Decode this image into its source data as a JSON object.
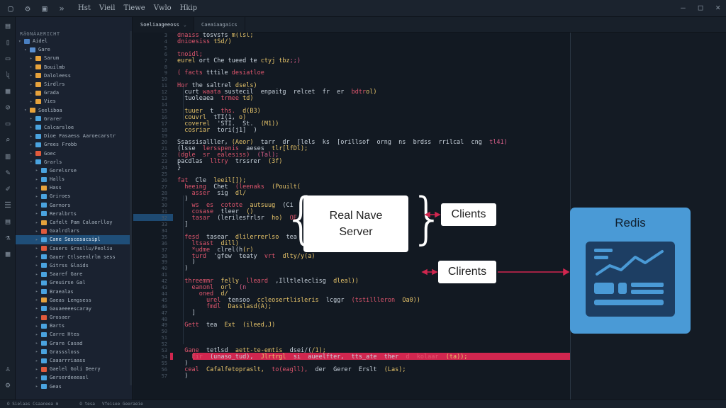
{
  "titlebar": {
    "menu": [
      "Hst",
      "Vieil",
      "Tiewe",
      "Vwlo",
      "Hkip"
    ],
    "controls": [
      "–",
      "□",
      "✕"
    ]
  },
  "explorer": {
    "header": "RäGNÀAERICHT",
    "items": [
      {
        "label": "Aidel",
        "depth": 0,
        "color": "#4a7fc1",
        "caret": "▾"
      },
      {
        "label": "Gare",
        "depth": 1,
        "color": "#5a8fd0",
        "caret": "▾"
      },
      {
        "label": "Sarum",
        "depth": 2,
        "color": "#e6a23c",
        "caret": "▸"
      },
      {
        "label": "Bouilmb",
        "depth": 2,
        "color": "#e6a23c",
        "caret": "▸"
      },
      {
        "label": "Daloleess",
        "depth": 2,
        "color": "#e6a23c",
        "caret": "▸"
      },
      {
        "label": "Sirdlrs",
        "depth": 2,
        "color": "#e6a23c",
        "caret": "▸"
      },
      {
        "label": "Grada",
        "depth": 2,
        "color": "#e6a23c",
        "caret": "▸"
      },
      {
        "label": "Vies",
        "depth": 2,
        "color": "#e6a23c",
        "caret": "▸"
      },
      {
        "label": "Seeliboa",
        "depth": 1,
        "color": "#e6a23c",
        "caret": "▾"
      },
      {
        "label": "Grarer",
        "depth": 2,
        "color": "#4aa3df",
        "caret": "▸"
      },
      {
        "label": "Calcarsloe",
        "depth": 2,
        "color": "#4aa3df",
        "caret": "▸"
      },
      {
        "label": "Dioe Fasaess Aaroecarstr",
        "depth": 2,
        "color": "#4aa3df",
        "caret": "▸"
      },
      {
        "label": "Grees Frobb",
        "depth": 2,
        "color": "#4aa3df",
        "caret": "▸"
      },
      {
        "label": "Goec",
        "depth": 2,
        "color": "#e05a3c",
        "caret": "▸"
      },
      {
        "label": "Grarls",
        "depth": 2,
        "color": "#4aa3df",
        "caret": "▾"
      },
      {
        "label": "Gorelsrse",
        "depth": 3,
        "color": "#4aa3df",
        "caret": "▸"
      },
      {
        "label": "Halls",
        "depth": 3,
        "color": "#4aa3df",
        "caret": "▸"
      },
      {
        "label": "Hass",
        "depth": 3,
        "color": "#e6a23c",
        "caret": "▸"
      },
      {
        "label": "Griroes",
        "depth": 3,
        "color": "#4aa3df",
        "caret": "▸"
      },
      {
        "label": "Garnors",
        "depth": 3,
        "color": "#4aa3df",
        "caret": "▸"
      },
      {
        "label": "Reralbrts",
        "depth": 3,
        "color": "#4aa3df",
        "caret": "▸"
      },
      {
        "label": "Cafelt Pam Calaerlloy",
        "depth": 3,
        "color": "#e6a23c",
        "caret": "▸"
      },
      {
        "label": "Gxalrdlars",
        "depth": 3,
        "color": "#e05a3c",
        "caret": "▸"
      },
      {
        "label": "Cane Sescesacsipl",
        "depth": 3,
        "color": "#4aa3df",
        "caret": "▸",
        "selected": true
      },
      {
        "label": "Cauers Grasllu/Peoliu",
        "depth": 3,
        "color": "#e05a3c",
        "caret": "▸"
      },
      {
        "label": "Gauer Ctlseenlrlm sess",
        "depth": 3,
        "color": "#4aa3df",
        "caret": "▸"
      },
      {
        "label": "Gitrss Glaids",
        "depth": 3,
        "color": "#4aa3df",
        "caret": "▸"
      },
      {
        "label": "Saaref Gare",
        "depth": 3,
        "color": "#4aa3df",
        "caret": "▸"
      },
      {
        "label": "Greuirse Gal",
        "depth": 3,
        "color": "#4aa3df",
        "caret": "▸"
      },
      {
        "label": "Braealas",
        "depth": 3,
        "color": "#4aa3df",
        "caret": "▸"
      },
      {
        "label": "Gaeas Lengsess",
        "depth": 3,
        "color": "#e6a23c",
        "caret": "▸"
      },
      {
        "label": "Gauaeeeescaray",
        "depth": 3,
        "color": "#4aa3df",
        "caret": "▸"
      },
      {
        "label": "Grosaer",
        "depth": 3,
        "color": "#e05a3c",
        "caret": "▸"
      },
      {
        "label": "Barts",
        "depth": 3,
        "color": "#4aa3df",
        "caret": "▸"
      },
      {
        "label": "Carre Htes",
        "depth": 3,
        "color": "#4aa3df",
        "caret": "▸"
      },
      {
        "label": "Grare Casad",
        "depth": 3,
        "color": "#4aa3df",
        "caret": "▸"
      },
      {
        "label": "Grasssloss",
        "depth": 3,
        "color": "#4aa3df",
        "caret": "▸"
      },
      {
        "label": "Caaarrriaass",
        "depth": 3,
        "color": "#4aa3df",
        "caret": "▸"
      },
      {
        "label": "Gaelel Goli Deery",
        "depth": 3,
        "color": "#e05a3c",
        "caret": "▸"
      },
      {
        "label": "Gerserdeeeasl",
        "depth": 3,
        "color": "#4aa3df",
        "caret": "▸"
      },
      {
        "label": "Geas",
        "depth": 3,
        "color": "#4aa3df",
        "caret": "▸"
      }
    ]
  },
  "tabs": [
    {
      "label": "Soeliaageeoss",
      "active": true
    },
    {
      "label": "Caeaiaagaics",
      "active": false
    }
  ],
  "editor": {
    "lines": [
      {
        "n": "3",
        "text": [
          [
            "kw",
            "dnaiss "
          ],
          [
            "st",
            "tosvsfs "
          ],
          [
            "fn",
            "m(lsl;"
          ]
        ]
      },
      {
        "n": "4",
        "text": [
          [
            "kw",
            "dnioesiss "
          ],
          [
            "fn",
            "tSd/)"
          ]
        ]
      },
      {
        "n": "5",
        "text": []
      },
      {
        "n": "6",
        "text": [
          [
            "kw",
            "tnoidl;"
          ]
        ]
      },
      {
        "n": "7",
        "text": [
          [
            "fn",
            "eurel "
          ],
          [
            "st",
            "ort Che tueed te "
          ],
          [
            "fn",
            "ctyj tbz"
          ],
          [
            "pu",
            ";;)"
          ]
        ]
      },
      {
        "n": "8",
        "text": []
      },
      {
        "n": "9",
        "text": [
          [
            "kw",
            "( facts "
          ],
          [
            "st",
            "tttile "
          ],
          [
            "kw",
            "desiatloe"
          ]
        ]
      },
      {
        "n": "10",
        "text": []
      },
      {
        "n": "11",
        "text": [
          [
            "kw",
            "Hor "
          ],
          [
            "st",
            "the saltrel "
          ],
          [
            "fn",
            "dsels)"
          ]
        ]
      },
      {
        "n": "12",
        "text": [
          [
            "st",
            "  curt "
          ],
          [
            "kw",
            "waata "
          ],
          [
            "st",
            "sustecil  enpaitg  relcet  fr  er  "
          ],
          [
            "kw",
            "bdtr"
          ],
          [
            "fn",
            "ol)"
          ]
        ]
      },
      {
        "n": "13",
        "text": [
          [
            "st",
            "  tuoleaea  "
          ],
          [
            "kw",
            "trmee "
          ],
          [
            "fn",
            "td)"
          ]
        ]
      },
      {
        "n": "14",
        "text": []
      },
      {
        "n": "15",
        "text": [
          [
            "fn",
            "  tuuer  "
          ],
          [
            "st",
            "t  "
          ],
          [
            "kw",
            "ths.  "
          ],
          [
            "fn",
            "d(B3)"
          ]
        ]
      },
      {
        "n": "16",
        "text": [
          [
            "fn",
            "  couvrl  "
          ],
          [
            "st",
            "tTI(1, "
          ],
          [
            "fn",
            "o)"
          ]
        ]
      },
      {
        "n": "17",
        "text": [
          [
            "fn",
            "  coverel  "
          ],
          [
            "st",
            "'STI.  St.  "
          ],
          [
            "fn",
            "(M1))"
          ]
        ]
      },
      {
        "n": "18",
        "text": [
          [
            "fn",
            "  cosriar  "
          ],
          [
            "st",
            "tori(j1]  )"
          ]
        ]
      },
      {
        "n": "19",
        "text": []
      },
      {
        "n": "20",
        "text": [
          [
            "st",
            "Ssassisalller, "
          ],
          [
            "fn",
            "(Aeor)  "
          ],
          [
            "st",
            "tarr  dr  [lels  ks  [orillsof  orng  ns  brdss  rrilcal  cng  "
          ],
          [
            "pu",
            "tl41)"
          ]
        ]
      },
      {
        "n": "21",
        "text": [
          [
            "st",
            "(lsse  "
          ],
          [
            "kw",
            "lersspenis  "
          ],
          [
            "st",
            "aeses  "
          ],
          [
            "fn",
            "tlr[lfDl);"
          ]
        ]
      },
      {
        "n": "22",
        "text": [
          [
            "kw",
            "(dgle  sr  ealesiss)  "
          ],
          [
            "pu",
            "(Tal);"
          ]
        ]
      },
      {
        "n": "23",
        "text": [
          [
            "st",
            "pacdlas  "
          ],
          [
            "kw",
            "lltry  "
          ],
          [
            "st",
            "trssrer  "
          ],
          [
            "fn",
            "(3f)"
          ]
        ]
      },
      {
        "n": "24",
        "text": [
          [
            "st",
            "}"
          ]
        ]
      },
      {
        "n": "25",
        "text": []
      },
      {
        "n": "26",
        "text": [
          [
            "kw",
            "fat  "
          ],
          [
            "st",
            "Cle  "
          ],
          [
            "fn",
            "leeil[]);"
          ]
        ]
      },
      {
        "n": "27",
        "text": [
          [
            "kw",
            "  heeing  "
          ],
          [
            "st",
            "Chet  "
          ],
          [
            "kw",
            "(leenaks  "
          ],
          [
            "fn",
            "(Pouilt("
          ]
        ]
      },
      {
        "n": "28",
        "text": [
          [
            "kw",
            "    asser  "
          ],
          [
            "st",
            "sig  "
          ],
          [
            "fn",
            "dl/"
          ]
        ]
      },
      {
        "n": "29",
        "text": [
          [
            "st",
            "  )"
          ]
        ]
      },
      {
        "n": "30",
        "text": [
          [
            "kw",
            "    ws  es  cotote  "
          ],
          [
            "fn",
            "autsuug  "
          ],
          [
            "st",
            "(Ci"
          ]
        ]
      },
      {
        "n": "31",
        "text": [
          [
            "kw",
            "    cosase  "
          ],
          [
            "st",
            "tleer  "
          ],
          [
            "fn",
            "()"
          ]
        ]
      },
      {
        "n": "32",
        "text": [
          [
            "kw",
            "    tasar  "
          ],
          [
            "st",
            "(lerilesfrlsr  "
          ],
          [
            "fn",
            "ho)  "
          ],
          [
            "kw",
            "OE"
          ]
        ]
      },
      {
        "n": "33",
        "text": [
          [
            "st",
            "  ]"
          ]
        ]
      },
      {
        "n": "34",
        "text": []
      },
      {
        "n": "35",
        "text": [
          [
            "kw",
            "  fesd  "
          ],
          [
            "st",
            "tasear  "
          ],
          [
            "fn",
            "dlilerrerlso  "
          ],
          [
            "st",
            "tea  "
          ],
          [
            "kw",
            "Do"
          ]
        ]
      },
      {
        "n": "36",
        "text": [
          [
            "kw",
            "    ltsast  "
          ],
          [
            "fn",
            "dill)"
          ]
        ]
      },
      {
        "n": "37",
        "text": [
          [
            "kw",
            "    *udme  "
          ],
          [
            "st",
            "clrel(h"
          ],
          [
            "fn",
            "(r)"
          ]
        ]
      },
      {
        "n": "38",
        "text": [
          [
            "kw",
            "    turd  "
          ],
          [
            "st",
            "'gfew  teaty  "
          ],
          [
            "kw",
            "vrt  "
          ],
          [
            "fn",
            "dlty/y(a)"
          ]
        ]
      },
      {
        "n": "39",
        "text": [
          [
            "st",
            "    )"
          ]
        ]
      },
      {
        "n": "40",
        "text": [
          [
            "st",
            "  )"
          ]
        ]
      },
      {
        "n": "41",
        "text": []
      },
      {
        "n": "42",
        "text": [
          [
            "kw",
            "  threemmr  "
          ],
          [
            "fn",
            "felly  "
          ],
          [
            "kw",
            "lleard  "
          ],
          [
            "st",
            ",Illtleleclisg  "
          ],
          [
            "fn",
            "dleal))"
          ]
        ]
      },
      {
        "n": "43",
        "text": [
          [
            "kw",
            "    eanonl  "
          ],
          [
            "fn",
            "orl  "
          ],
          [
            "pu",
            "(n"
          ]
        ]
      },
      {
        "n": "44",
        "text": [
          [
            "kw",
            "      oned  "
          ],
          [
            "fn",
            "d/"
          ]
        ]
      },
      {
        "n": "45",
        "text": [
          [
            "kw",
            "        urel  "
          ],
          [
            "st",
            "tensoo  "
          ],
          [
            "fn",
            "ccleosertlisleris  "
          ],
          [
            "st",
            "lcggr  "
          ],
          [
            "kw",
            "(tstillleron  "
          ],
          [
            "fn",
            "Oa0))"
          ]
        ]
      },
      {
        "n": "46",
        "text": [
          [
            "kw",
            "        fmdl  "
          ],
          [
            "fn",
            "Dasslasd(A);"
          ]
        ]
      },
      {
        "n": "47",
        "text": [
          [
            "st",
            "    ]"
          ]
        ]
      },
      {
        "n": "48",
        "text": [
          [
            "st",
            "  "
          ]
        ]
      },
      {
        "n": "49",
        "text": [
          [
            "kw",
            "  Gett  "
          ],
          [
            "st",
            "tea  "
          ],
          [
            "fn",
            "Ext  (ileed,J)"
          ]
        ]
      },
      {
        "n": "50",
        "text": []
      },
      {
        "n": "51",
        "text": []
      },
      {
        "n": "52",
        "text": []
      },
      {
        "n": "53",
        "text": [
          [
            "kw",
            "  Gane  "
          ],
          [
            "st",
            "tetlsd  "
          ],
          [
            "fn",
            "aett-te-emtis  "
          ],
          [
            "st",
            "dsei/("
          ],
          [
            "fn",
            "/1);"
          ]
        ]
      },
      {
        "n": "54",
        "text": [
          [
            "kw",
            "    Eir  "
          ],
          [
            "st",
            "(unaso_tud),  "
          ],
          [
            "fn",
            "Jlrtrgl  "
          ],
          [
            "st",
            "si  aueelfter,  tts_ate  ther  "
          ],
          [
            "kw",
            "d  kolaar  "
          ],
          [
            "fn",
            "(ta));"
          ]
        ]
      },
      {
        "n": "55",
        "text": [
          [
            "st",
            "  )"
          ]
        ]
      },
      {
        "n": "56",
        "text": [
          [
            "kw",
            "  ceal  "
          ],
          [
            "fn",
            "Cafalfetopraslt,  "
          ],
          [
            "kw",
            "to(eagll),  "
          ],
          [
            "st",
            "der  Gerer  Erslt  "
          ],
          [
            "fn",
            "(Las);"
          ]
        ]
      },
      {
        "n": "57",
        "text": [
          [
            "st",
            "  )"
          ]
        ]
      }
    ]
  },
  "diagram": {
    "server_label_line1": "Real Nave",
    "server_label_line2": "Server",
    "client_label_1": "Clients",
    "client_label_2": "Clirents",
    "redis_label": "Redis",
    "arrow_color": "#d1264f",
    "redis_color": "#4a9ad6"
  },
  "statusbar": {
    "items": [
      "O Sielaas Csaaneea  m",
      "O tesa",
      "Vfeisee Geeraeie"
    ]
  }
}
